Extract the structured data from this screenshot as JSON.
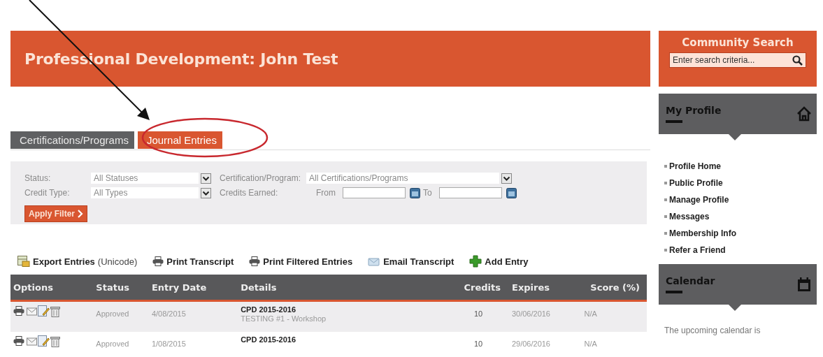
{
  "header": {
    "title": "Professional Development: John Test"
  },
  "tabs": [
    {
      "label": "Certifications/Programs",
      "selected": false
    },
    {
      "label": "Journal Entries",
      "selected": true
    }
  ],
  "filters": {
    "status": {
      "label": "Status:",
      "value": "All Statuses"
    },
    "certification": {
      "label": "Certification/Program:",
      "value": "All Certifications/Programs"
    },
    "credit_type": {
      "label": "Credit Type:",
      "value": "All Types"
    },
    "credits_earned": {
      "label": "Credits Earned:",
      "from_label": "From",
      "to_label": "To"
    },
    "apply_button": "Apply Filter"
  },
  "actions": [
    {
      "kind": "export",
      "label": "Export Entries",
      "note": "(Unicode)"
    },
    {
      "kind": "print",
      "label": "Print Transcript"
    },
    {
      "kind": "print",
      "label": "Print Filtered Entries"
    },
    {
      "kind": "email",
      "label": "Email Transcript"
    },
    {
      "kind": "add",
      "label": "Add Entry"
    }
  ],
  "table": {
    "columns": [
      "Options",
      "Status",
      "Entry Date",
      "Details",
      "Credits",
      "Expires",
      "Score (%)"
    ],
    "rows": [
      {
        "status": "Approved",
        "entry_date": "4/08/2015",
        "program": "CPD 2015-2016",
        "activity": "TESTING #1 - Workshop",
        "credits": "10",
        "expires": "30/06/2016",
        "score": "N/A"
      },
      {
        "status": "Approved",
        "entry_date": "1/08/2015",
        "program": "CPD 2015-2016",
        "credits": "10",
        "expires": "29/06/2016",
        "score": "N/A"
      }
    ]
  },
  "sidebar": {
    "search": {
      "title": "Community Search",
      "placeholder": "Enter search criteria..."
    },
    "profile": {
      "title": "My Profile",
      "links": [
        "Profile Home",
        "Public Profile",
        "Manage Profile",
        "Messages",
        "Membership Info",
        "Refer a Friend"
      ]
    },
    "calendar": {
      "title": "Calendar",
      "message": "The upcoming calendar is"
    }
  }
}
